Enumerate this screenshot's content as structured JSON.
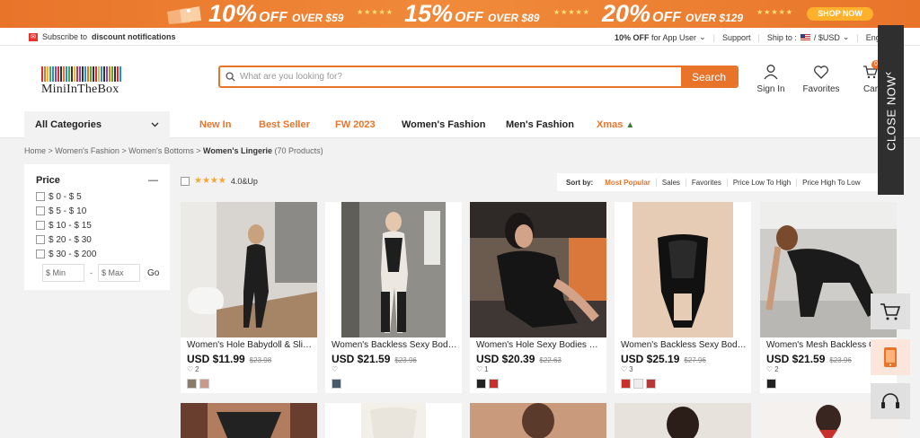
{
  "promo": {
    "deals": [
      {
        "pct": "10%",
        "off": "OFF",
        "over": "OVER $59"
      },
      {
        "pct": "15%",
        "off": "OFF",
        "over": "OVER $89"
      },
      {
        "pct": "20%",
        "off": "OFF",
        "over": "OVER $129"
      }
    ],
    "shop_now": "SHOP NOW"
  },
  "util": {
    "subscribe_pre": "Subscribe to",
    "subscribe_bold": "discount notifications",
    "app_offer_bold": "10% OFF",
    "app_offer_rest": "for App User",
    "support": "Support",
    "ship_to": "Ship to :",
    "currency": "$USD",
    "language": "Engl"
  },
  "header": {
    "brand": "MiniInTheBox",
    "search_placeholder": "What are you looking for?",
    "search_button": "Search",
    "sign_in": "Sign In",
    "favorites": "Favorites",
    "cart": "Car",
    "cart_count": "0"
  },
  "nav": {
    "all_categories": "All Categories",
    "items": [
      "New In",
      "Best Seller",
      "FW 2023",
      "Women's Fashion",
      "Men's Fashion",
      "Xmas"
    ]
  },
  "breadcrumb": {
    "home": "Home",
    "l1": "Women's Fashion",
    "l2": "Women's Bottoms",
    "current": "Women's Lingerie",
    "count": "(70 Products)"
  },
  "filters": {
    "price_title": "Price",
    "ranges": [
      "$ 0 - $ 5",
      "$ 5 - $ 10",
      "$ 10 - $ 15",
      "$ 20 - $ 30",
      "$ 30 - $ 200"
    ],
    "min_placeholder": "$ Min",
    "max_placeholder": "$ Max",
    "go": "Go",
    "rating_label": "4.0&Up"
  },
  "sort": {
    "label": "Sort by:",
    "options": [
      "Most Popular",
      "Sales",
      "Favorites",
      "Price Low To High",
      "Price High To Low"
    ],
    "active": "Most Popular"
  },
  "products": [
    {
      "name": "Women's Hole Babydoll & Slips Sexy",
      "price": "USD $11.99",
      "orig": "$23.98",
      "likes": "2"
    },
    {
      "name": "Women's Backless Sexy Bodies",
      "price": "USD $21.59",
      "orig": "$23.96",
      "likes": ""
    },
    {
      "name": "Women's Hole Sexy Bodies Lingerie",
      "price": "USD $20.39",
      "orig": "$22.63",
      "likes": "1"
    },
    {
      "name": "Women's Backless Sexy Bodies",
      "price": "USD $25.19",
      "orig": "$27.96",
      "likes": "3"
    },
    {
      "name": "Women's Mesh Backless Cut Out",
      "price": "USD $21.59",
      "orig": "$23.96",
      "likes": "2"
    }
  ],
  "floating": {
    "close_now": "CLOSE NOW"
  },
  "colors": {
    "accent": "#e8742a",
    "dark_panel": "#2f2f2f"
  }
}
